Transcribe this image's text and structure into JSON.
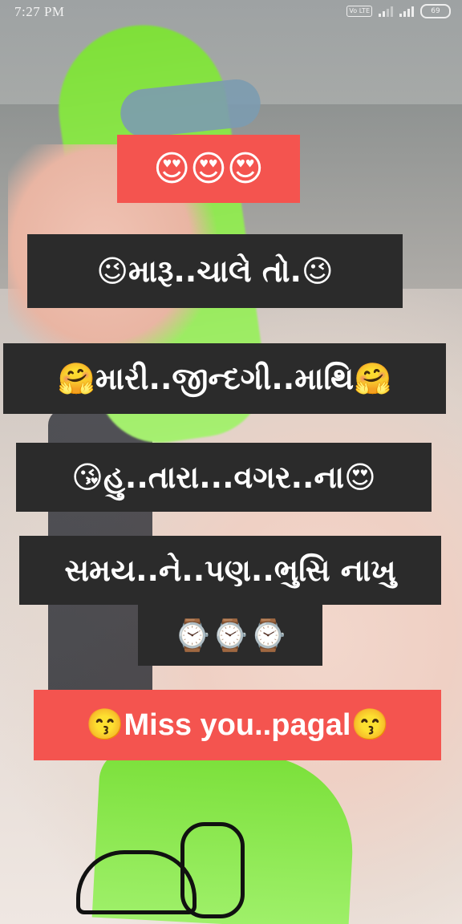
{
  "status_bar": {
    "time": "7:27 PM",
    "volte": "Vo LTE",
    "battery": "69"
  },
  "lines": {
    "line1_emoji": "😍😍😍",
    "line2": "😉મારૂ..ચાલે તો.😉",
    "line3": "🤗મારી..જીન્દગી..માથિ🤗",
    "line4": "😘હુ..તારા...વગર..ના😍",
    "line5": "સમય..ને..પણ..ભુસિ નાખુ",
    "line6_emoji": "⌚⌚⌚",
    "line7": "😙Miss you..pagal😙"
  },
  "colors": {
    "dark_box": "#2b2b2b",
    "red_box": "#f4544f",
    "text": "#ffffff"
  }
}
